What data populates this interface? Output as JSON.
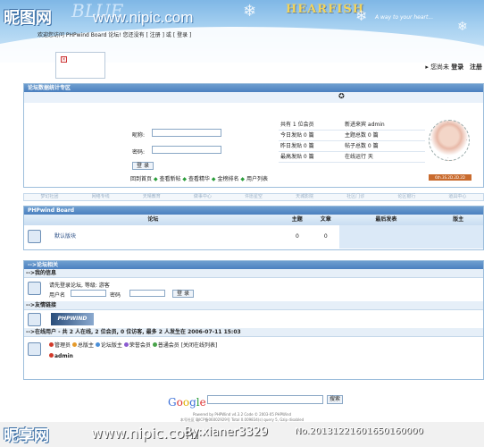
{
  "header": {
    "site_logo": "昵图网",
    "blue_word": "BLUE",
    "site_url": "www.nipic.com",
    "brand": "HEARFISH",
    "tagline": "A way to your heart..."
  },
  "user_bar": {
    "prefix": "您尚未",
    "login": "登录",
    "register": "注册"
  },
  "stats_panel": {
    "title": "论坛数据统计专区",
    "welcome": "欢迎您访问 PHPwind Board 论坛! 您还没有 [ 注册 ] 或 [ 登录 ]",
    "nickname_label": "昵称:",
    "password_label": "密码:",
    "login_button": "登 录",
    "quick_links": [
      "回到首页",
      "查看新帖",
      "查看精华",
      "金榜排名",
      "用户列表"
    ],
    "stats": [
      [
        "共有 1 位会员",
        "新进来宾 admin"
      ],
      [
        "今日发贴 0 篇",
        "主题总数 0 篇"
      ],
      [
        "昨日发贴 0 篇",
        "帖子总数 0 篇"
      ],
      [
        "最高发贴 0 篇",
        "在线运行 天"
      ]
    ],
    "badge": "6th.3S.2D.2D.2D"
  },
  "nav_strip": [
    "梦幻社团",
    "网络专线",
    "天晴教育",
    "做事中心",
    "许愿星空",
    "天城影院",
    "社区门诊",
    "论区银行",
    "道具中心"
  ],
  "forum": {
    "board_title": "PHPwind Board",
    "columns": {
      "forum": "论坛",
      "topics": "主题",
      "posts": "文章",
      "last": "最后发表",
      "mod": "版主"
    },
    "rows": [
      {
        "name": "默认版块",
        "topics": "0",
        "posts": "0",
        "last": "",
        "mod": ""
      }
    ]
  },
  "related": {
    "title": "-->论坛相关",
    "info_title": "-->我的信息",
    "info_text": "请先登录论坛, 等级: 游客",
    "username_label": "用户名",
    "password_label": "密码",
    "login_button": "登 录",
    "links_title": "-->友情链接",
    "link_logo": "PHPWIND",
    "online_title": "-->在线用户 - 共 2 人在线, 2 位会员, 0 位访客, 最多 2 人发生在 2006-07-11 15:03",
    "legend": [
      "管理员",
      "总版主",
      "论坛版主",
      "荣誉会员",
      "普通会员"
    ],
    "legend_colors": [
      "#d23a2a",
      "#e59a2a",
      "#4a8fd8",
      "#8a5bd0",
      "#48a34a"
    ],
    "legend_suffix": "[关闭在线列表]",
    "online_user": "admin"
  },
  "footer": {
    "google": "Google",
    "search_button": "搜索",
    "powered": "Powered by PHPWind v4.3.2 Code © 2003-05 PHPWind",
    "icp": "本号社区 赣ICP备06002929号  Total 0.009834(s) query 5, Gzip disabled"
  },
  "watermark": {
    "logo": "昵享网",
    "url": "www.nipic.com",
    "id": "By:xianer3329",
    "meta": "No.20131221601650160000"
  }
}
